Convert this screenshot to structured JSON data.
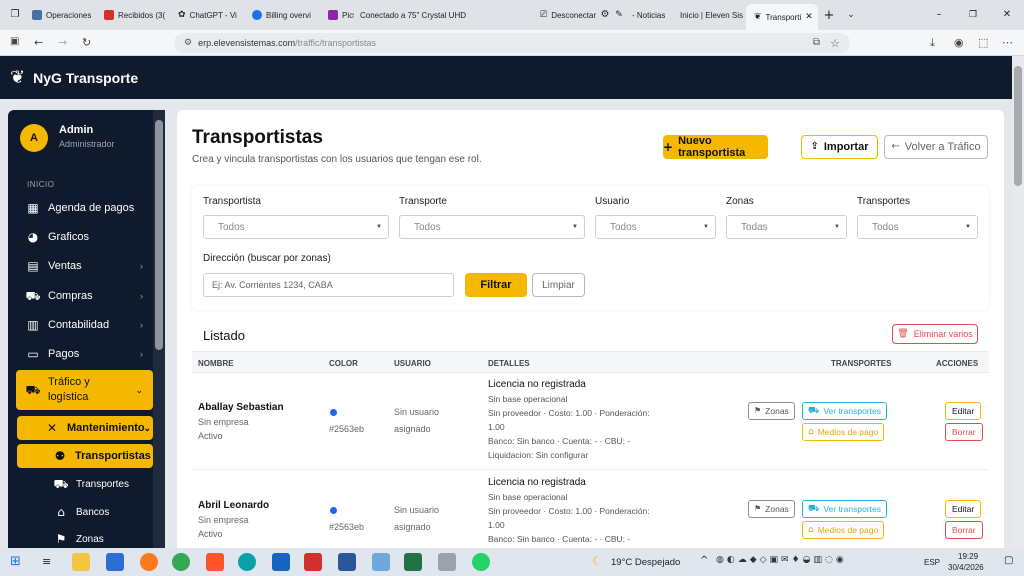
{
  "browser": {
    "tabs": [
      {
        "label": "Operaciones",
        "color": "#4a6fa5"
      },
      {
        "label": "Recibidos (3(",
        "color": "#d93025"
      },
      {
        "label": "ChatGPT - Vi",
        "color": "#333333"
      },
      {
        "label": "Billing overvi",
        "color": "#1a73e8"
      },
      {
        "label": "Pict",
        "color": "#8e24aa"
      },
      {
        "label": "Conectado a 75\" Crystal UHD",
        "color": ""
      },
      {
        "label": "Desconectar",
        "color": ""
      },
      {
        "label": "- Noticias",
        "color": ""
      },
      {
        "label": "Inicio | Eleven Sis",
        "color": ""
      },
      {
        "label": "Transporti",
        "color": "#0f1b2d"
      }
    ],
    "url_host": "erp.elevensistemas.com",
    "url_path": "/traffic/transportistas"
  },
  "app": {
    "brand": "NyG Transporte"
  },
  "sidebar": {
    "user_initial": "A",
    "user_name": "Admin",
    "user_role": "Administrador",
    "section": "INICIO",
    "items": {
      "agenda": "Agenda de pagos",
      "graficos": "Graficos",
      "ventas": "Ventas",
      "compras": "Compras",
      "contabilidad": "Contabilidad",
      "pagos": "Pagos",
      "trafico": "Tráfico y logística",
      "mantenimiento": "Mantenimiento",
      "transportistas": "Transportistas",
      "transportes": "Transportes",
      "bancos": "Bancos",
      "zonas": "Zonas"
    }
  },
  "page": {
    "title": "Transportistas",
    "subtitle": "Crea y vincula transportistas con los usuarios que tengan ese rol.",
    "new_button": "Nuevo transportista",
    "import_button": "Importar",
    "back_button": "Volver a Tráfico"
  },
  "filters": {
    "transportista_label": "Transportista",
    "transportista_value": "Todos",
    "transporte_label": "Transporte",
    "transporte_value": "Todos",
    "usuario_label": "Usuario",
    "usuario_value": "Todos",
    "zonas_label": "Zonas",
    "zonas_value": "Todas",
    "transportes_label": "Transportes",
    "transportes_value": "Todos",
    "direccion_label": "Dirección (buscar por zonas)",
    "direccion_placeholder": "Ej: Av. Corrientes 1234, CABA",
    "filter_button": "Filtrar",
    "clear_button": "Limpiar"
  },
  "listing": {
    "title": "Listado",
    "delete_button": "Eliminar varios",
    "headers": {
      "nombre": "NOMBRE",
      "color": "COLOR",
      "usuario": "USUARIO",
      "detalles": "DETALLES",
      "transportes": "TRANSPORTES",
      "acciones": "ACCIONES"
    },
    "rows": [
      {
        "name": "Aballay Sebastian",
        "company": "Sin empresa",
        "status": "Activo",
        "color": "#2563eb",
        "user_1": "Sin usuario",
        "user_2": "asignado",
        "license": "Licencia no registrada",
        "base": "Sin base operacional",
        "provider": "Sin proveedor · Costo: 1.00 · Ponderación:",
        "weight": "1.00",
        "bank": "Banco: Sin banco · Cuenta: - · CBU: -",
        "liquidation": "Liquidacion: Sin configurar",
        "zonas": "Zonas",
        "ver_transportes": "Ver transportes",
        "medios": "Medios de pago",
        "edit": "Editar",
        "delete": "Borrar"
      },
      {
        "name": "Abril Leonardo",
        "company": "Sin empresa",
        "status": "Activo",
        "color": "#2563eb",
        "user_1": "Sin usuario",
        "user_2": "asignado",
        "license": "Licencia no registrada",
        "base": "Sin base operacional",
        "provider": "Sin proveedor · Costo: 1.00 · Ponderación:",
        "weight": "1.00",
        "bank": "Banco: Sin banco · Cuenta: - · CBU: -",
        "zonas": "Zonas",
        "ver_transportes": "Ver transportes",
        "medios": "Medios de pago",
        "edit": "Editar",
        "delete": "Borrar"
      }
    ]
  },
  "taskbar": {
    "weather": "19°C  Despejado",
    "lang": "ESP",
    "time": "19:29",
    "date": "30/4/2026"
  }
}
